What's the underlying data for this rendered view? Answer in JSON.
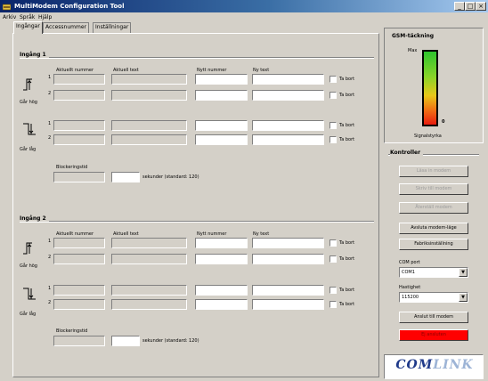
{
  "window": {
    "title": "MultiModem Configuration Tool",
    "min": "_",
    "max": "□",
    "close": "×"
  },
  "menu": [
    "Arkiv",
    "Språk",
    "Hjälp"
  ],
  "tabs": [
    "Ingångar",
    "Accessnummer",
    "Inställningar"
  ],
  "ingang1": {
    "title": "Ingång 1",
    "col_headers": {
      "alm_num": "Aktuellt nummer",
      "alm_text": "Aktuell text",
      "new_num": "Nytt nummer",
      "new_text": "Ny text"
    },
    "row_nums": [
      "1",
      "2",
      "1",
      "2"
    ],
    "checkbox_label": "Ta bort",
    "state_low": "Går hög",
    "state_high": "Går låg",
    "block_label": "Blockeringstid",
    "unit_label": "sekunder (standard: 120)"
  },
  "ingang2": {
    "title": "Ingång 2",
    "col_headers": {
      "alm_num": "Aktuellt nummer",
      "alm_text": "Aktuell text",
      "new_num": "Nytt nummer",
      "new_text": "Ny text"
    },
    "row_nums": [
      "1",
      "2",
      "1",
      "2"
    ],
    "checkbox_label": "Ta bort",
    "state_low": "Går hög",
    "state_high": "Går låg",
    "block_label": "Blockeringstid",
    "unit_label": "sekunder (standard: 120)"
  },
  "gsm": {
    "title": "GSM-täckning",
    "max": "Max",
    "value": "0",
    "sig_label": "Signalstyrka",
    "level_fraction": 0
  },
  "kontroller": {
    "title": "Kontroller",
    "buttons": [
      "Läsa in modem",
      "Skriv till modem",
      "Återställ modem"
    ],
    "btn_avsluta": "Avsluta modem-läge",
    "btn_fabrik": "Fabriksinställning",
    "com_label": "COM port",
    "com_value": "COM1",
    "baud_label": "Hastighet",
    "baud_value": "115200",
    "btn_anslut": "Anslut till modem",
    "btn_status": "Ej ansluten"
  },
  "logo": {
    "part1": "COM",
    "part2": "LINK",
    "color1": "#1f3a8a",
    "color2": "#9db4d6"
  },
  "colors": {
    "titlebar_start": "#0a246a",
    "titlebar_end": "#a6caf0",
    "status_red": "#ff0000"
  }
}
